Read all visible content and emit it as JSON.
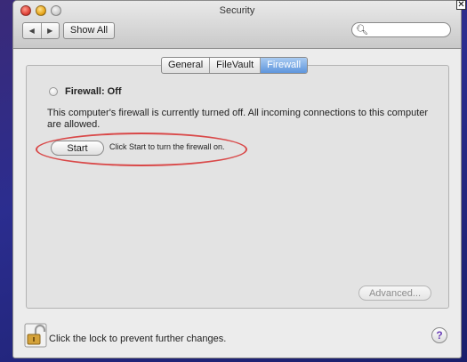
{
  "window": {
    "title": "Security"
  },
  "toolbar": {
    "back_glyph": "◀",
    "forward_glyph": "▶",
    "show_all_label": "Show All",
    "search_placeholder": ""
  },
  "tabs": [
    {
      "label": "General",
      "active": false
    },
    {
      "label": "FileVault",
      "active": false
    },
    {
      "label": "Firewall",
      "active": true
    }
  ],
  "firewall": {
    "status_label": "Firewall: Off",
    "description": "This computer's firewall is currently turned off. All incoming connections to this computer are allowed.",
    "start_label": "Start",
    "start_hint": "Click Start to turn the firewall on.",
    "advanced_label": "Advanced..."
  },
  "bottom": {
    "lock_text": "Click the lock to prevent further changes.",
    "help_glyph": "?"
  },
  "overlay": {
    "close_glyph": "✕",
    "highlight_color": "#d94848"
  },
  "colors": {
    "tab_active": "#5e95dc",
    "desktop": "#2b2d8f"
  },
  "icons": {
    "search": "magnifier-icon",
    "lock": "padlock-open-icon",
    "help": "question-mark-icon"
  }
}
